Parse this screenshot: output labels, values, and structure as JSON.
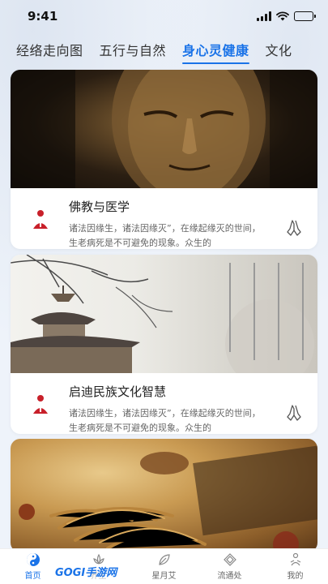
{
  "status_bar": {
    "time": "9:41"
  },
  "tabs": [
    {
      "label": "经络走向图",
      "active": false
    },
    {
      "label": "五行与自然",
      "active": false
    },
    {
      "label": "身心灵健康",
      "active": true
    },
    {
      "label": "文化",
      "active": false
    }
  ],
  "cards": [
    {
      "image": "buddha-face-image",
      "title": "佛教与医学",
      "desc": "诸法因缘生，诸法因缘灭”，在缘起缘灭的世间，生老病死是不可避免的现象。众生的"
    },
    {
      "image": "pagoda-image",
      "title": "启迪民族文化智慧",
      "desc": "诸法因缘生，诸法因缘灭”，在缘起缘灭的世间，生老病死是不可避免的现象。众生的"
    },
    {
      "image": "cordyceps-herb-image"
    }
  ],
  "bottom_nav": [
    {
      "label": "首页",
      "icon": "taichi-icon",
      "active": true
    },
    {
      "label": "养生",
      "icon": "lotus-icon",
      "active": false
    },
    {
      "label": "星月艾",
      "icon": "leaf-icon",
      "active": false
    },
    {
      "label": "流通处",
      "icon": "knot-icon",
      "active": false
    },
    {
      "label": "我的",
      "icon": "meditation-icon",
      "active": false
    }
  ],
  "watermark": "GOGI手游网",
  "colors": {
    "accent": "#1a73e8",
    "brand_red": "#c8202a"
  }
}
